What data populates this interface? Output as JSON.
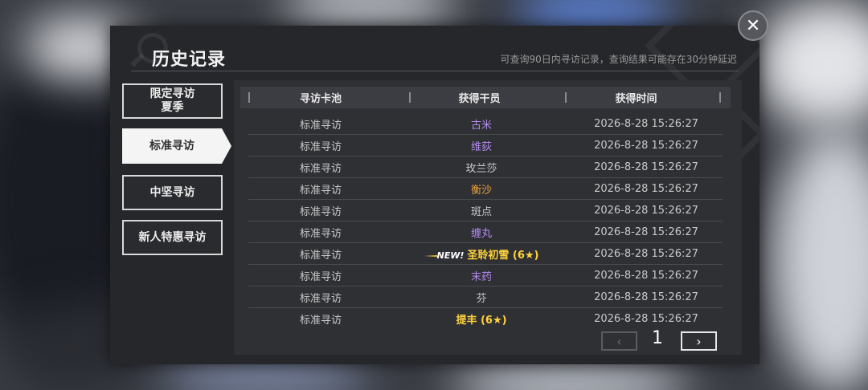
{
  "header": {
    "title": "历史记录",
    "subtitle": "可查询90日内寻访记录，查询结果可能存在30分钟延迟"
  },
  "tabs": [
    {
      "label": "限定寻访\n夏季",
      "active": false
    },
    {
      "label": "标准寻访",
      "active": true
    },
    {
      "label": "中坚寻访",
      "active": false
    },
    {
      "label": "新人特惠寻访",
      "active": false
    }
  ],
  "table": {
    "columns": [
      "寻访卡池",
      "获得干员",
      "获得时间"
    ],
    "rows": [
      {
        "pool": "标准寻访",
        "operator": "古米",
        "time": "2026-8-28 15:26:27",
        "color": "#b58cf0",
        "new": ""
      },
      {
        "pool": "标准寻访",
        "operator": "维荻",
        "time": "2026-8-28 15:26:27",
        "color": "#b58cf0",
        "new": ""
      },
      {
        "pool": "标准寻访",
        "operator": "玫兰莎",
        "time": "2026-8-28 15:26:27",
        "color": "#c9c9c9",
        "new": ""
      },
      {
        "pool": "标准寻访",
        "operator": "衡沙",
        "time": "2026-8-28 15:26:27",
        "color": "#f0a23a",
        "new": ""
      },
      {
        "pool": "标准寻访",
        "operator": "斑点",
        "time": "2026-8-28 15:26:27",
        "color": "#c9c9c9",
        "new": ""
      },
      {
        "pool": "标准寻访",
        "operator": "缠丸",
        "time": "2026-8-28 15:26:27",
        "color": "#b58cf0",
        "new": ""
      },
      {
        "pool": "标准寻访",
        "operator": "圣聆初雪 (6★)",
        "time": "2026-8-28 15:26:27",
        "color": "#ffd23c",
        "new": "NEW!"
      },
      {
        "pool": "标准寻访",
        "operator": "末药",
        "time": "2026-8-28 15:26:27",
        "color": "#b58cf0",
        "new": ""
      },
      {
        "pool": "标准寻访",
        "operator": "芬",
        "time": "2026-8-28 15:26:27",
        "color": "#c9c9c9",
        "new": ""
      },
      {
        "pool": "标准寻访",
        "operator": "提丰 (6★)",
        "time": "2026-8-28 15:26:27",
        "color": "#ffd23c",
        "new": ""
      }
    ]
  },
  "pagination": {
    "page": "1",
    "prev_icon": "chevron-left-icon",
    "next_icon": "chevron-right-icon",
    "prev_glyph": "‹",
    "next_glyph": "›"
  },
  "close": {
    "icon": "close-icon",
    "glyph": "✕"
  },
  "colors": {
    "rarity6": "#ffd23c",
    "rarity5": "#f0a23a",
    "rarity4": "#b58cf0",
    "rarity3": "#c9c9c9"
  }
}
